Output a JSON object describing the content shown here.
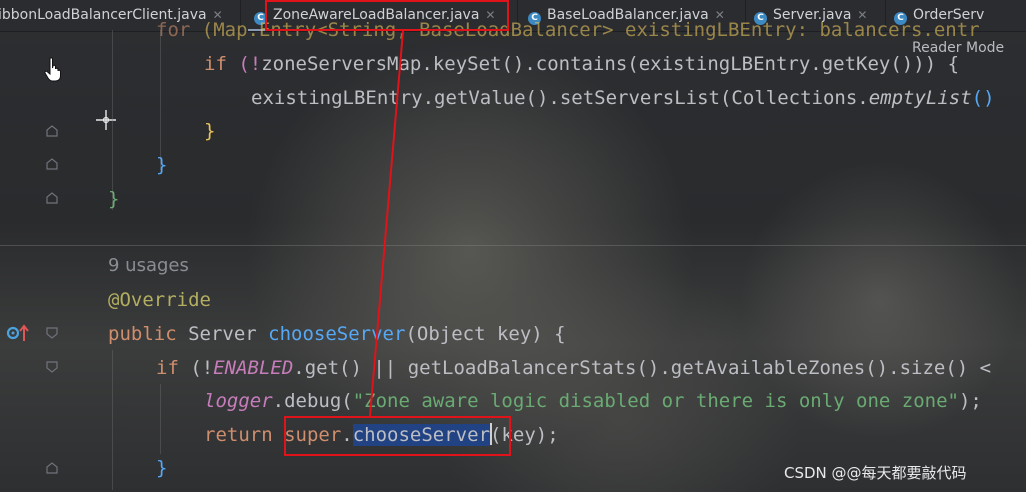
{
  "tabs": [
    {
      "label": "ibbonLoadBalancerClient.java",
      "icon": "java-class-icon",
      "has_close": true,
      "active": false
    },
    {
      "label": "ZoneAwareLoadBalancer.java",
      "icon": "java-class-icon",
      "has_close": true,
      "active": true
    },
    {
      "label": "BaseLoadBalancer.java",
      "icon": "java-class-icon",
      "has_close": true,
      "active": false
    },
    {
      "label": "Server.java",
      "icon": "java-class-icon",
      "has_close": true,
      "active": false
    },
    {
      "label": "OrderServ",
      "icon": "java-class-icon",
      "has_close": false,
      "active": false
    }
  ],
  "reader_mode_label": "Reader Mode",
  "code": {
    "line1": {
      "a": "for ",
      "b": "(Map.Entry<String, BaseLoadBalancer> existingLBEntry: balancers.entr"
    },
    "line2": {
      "kw": "if ",
      "a": "(!",
      "b": "zoneServersMap",
      "c": ".keySet().contains(existingLBEntry.getKey())) {"
    },
    "line3": {
      "a": "existingLBEntry.getValue().setServersList(Collections.",
      "b": "emptyList",
      "c": "()"
    },
    "line4": "}",
    "line5": "}",
    "line6": "}",
    "usages": "9 usages",
    "annotation": "@Override",
    "sig": {
      "kw": "public ",
      "type": "Server ",
      "name": "chooseServer",
      "params": "(Object key) {"
    },
    "if_line": {
      "kw": "if ",
      "a": "(!",
      "field": "ENABLED",
      "b": ".get() || ",
      "c": "getLoadBalancerStats().getAvailableZones().size() <"
    },
    "logger_line": {
      "field": "logger",
      "a": ".debug(",
      "str": "\"Zone aware logic disabled or there is only one zone\"",
      "b": ");"
    },
    "return_line": {
      "kw": "return ",
      "sup": "super",
      "dot": ".",
      "name": "chooseServer",
      "rest": "(key);"
    },
    "close_line": "}"
  },
  "watermark": "CSDN @@每天都要敲代码"
}
